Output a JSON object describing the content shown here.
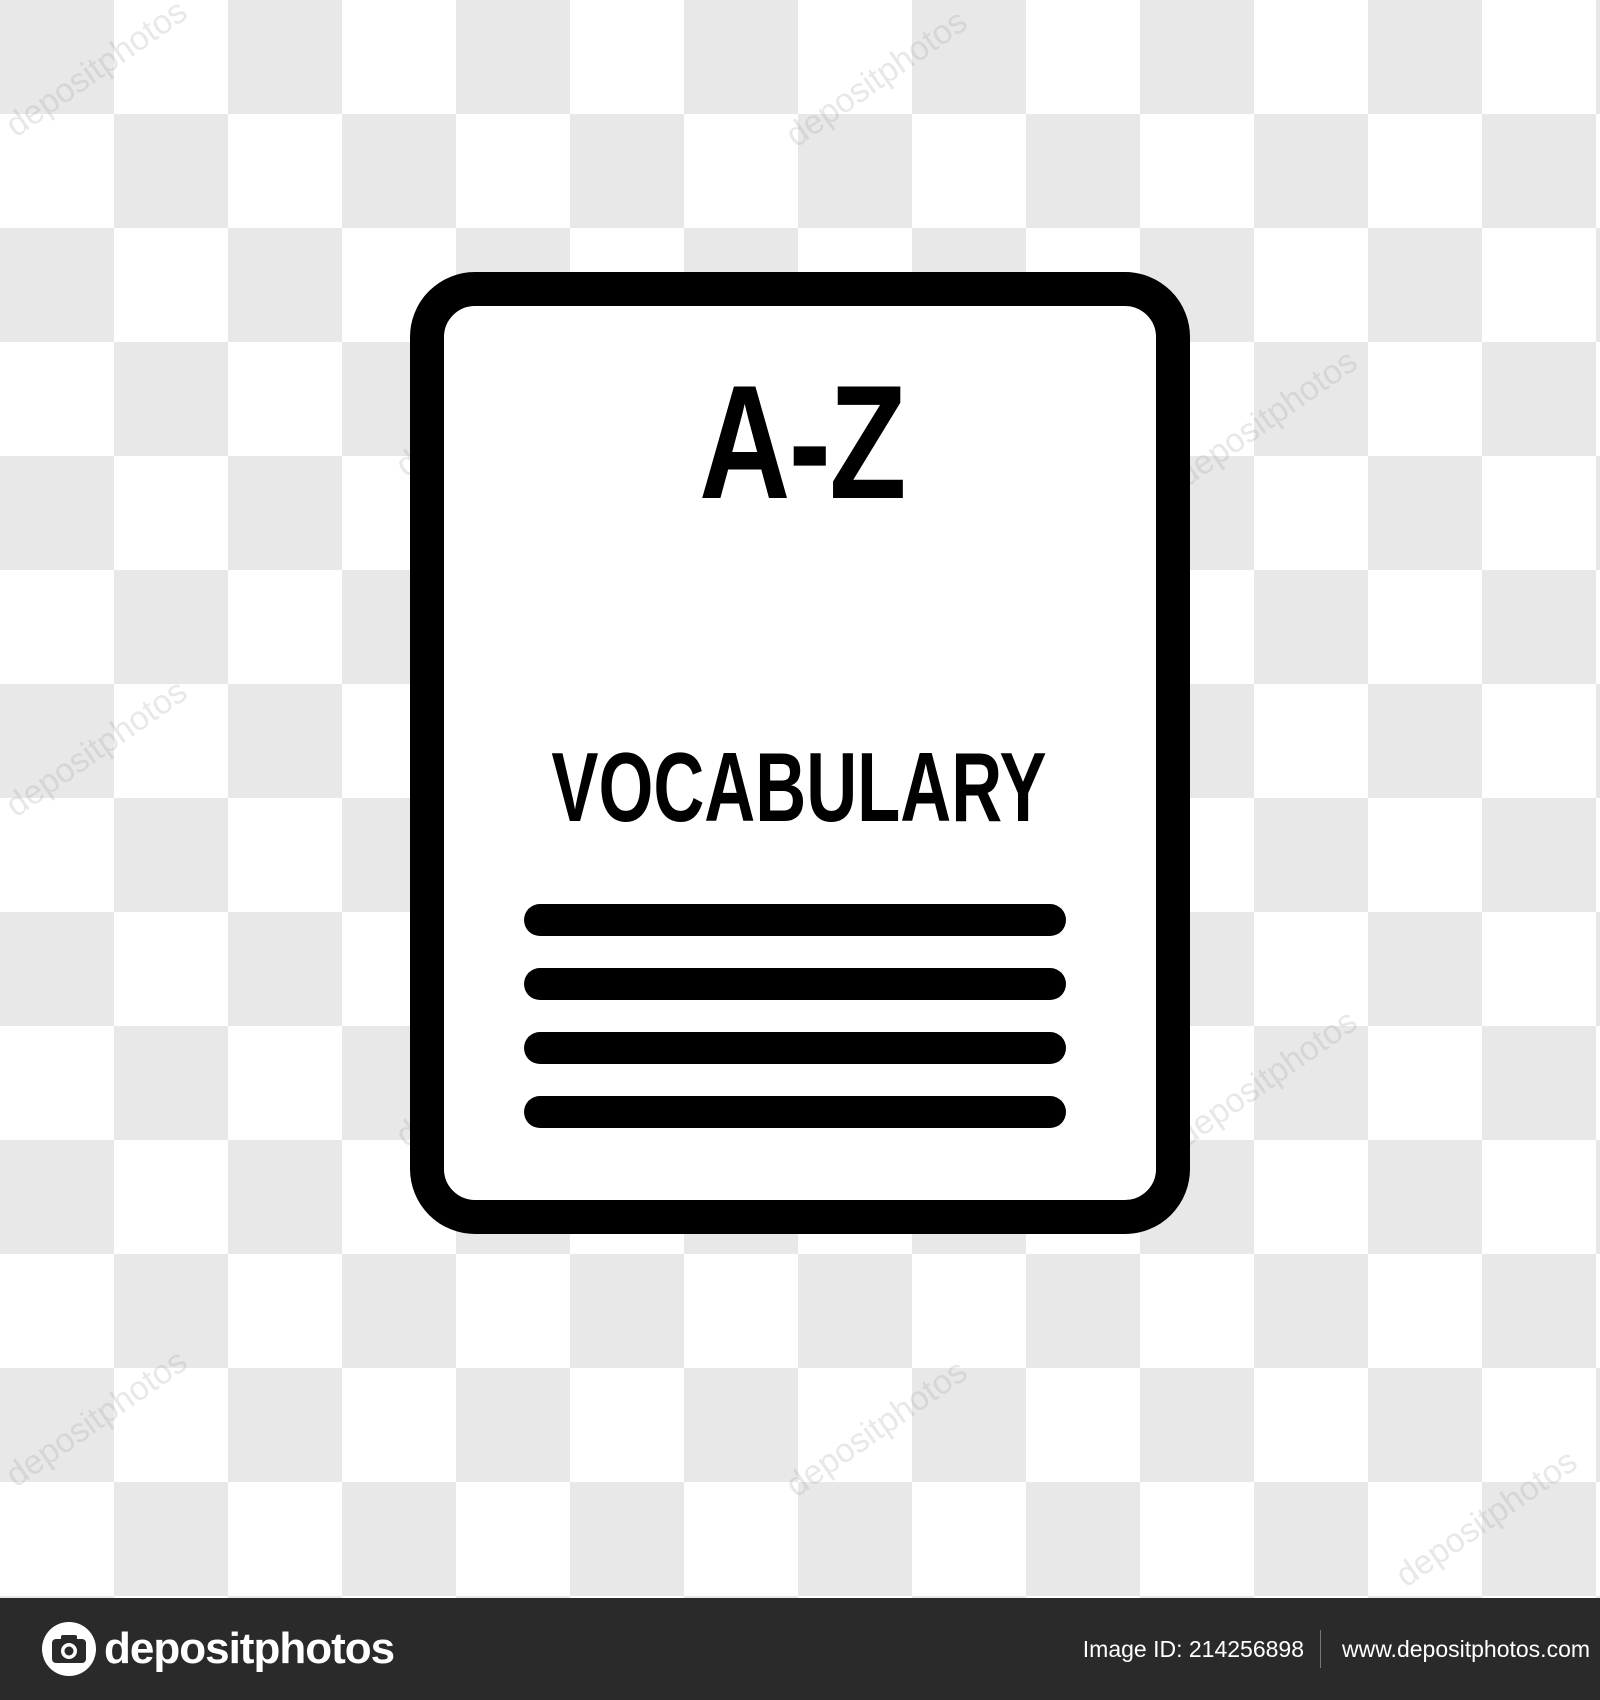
{
  "icon": {
    "title": "A-Z",
    "subtitle": "VOCABULARY",
    "text_line_count": 4
  },
  "watermark": "depositphotos",
  "footer": {
    "brand": "depositphotos",
    "image_id": "Image ID: 214256898",
    "url": "www.depositphotos.com"
  },
  "colors": {
    "checker_light": "#ffffff",
    "checker_dark": "#e8e8e8",
    "icon_stroke": "#000000",
    "footer_bg": "#2a2a2a",
    "footer_text": "#ffffff"
  }
}
